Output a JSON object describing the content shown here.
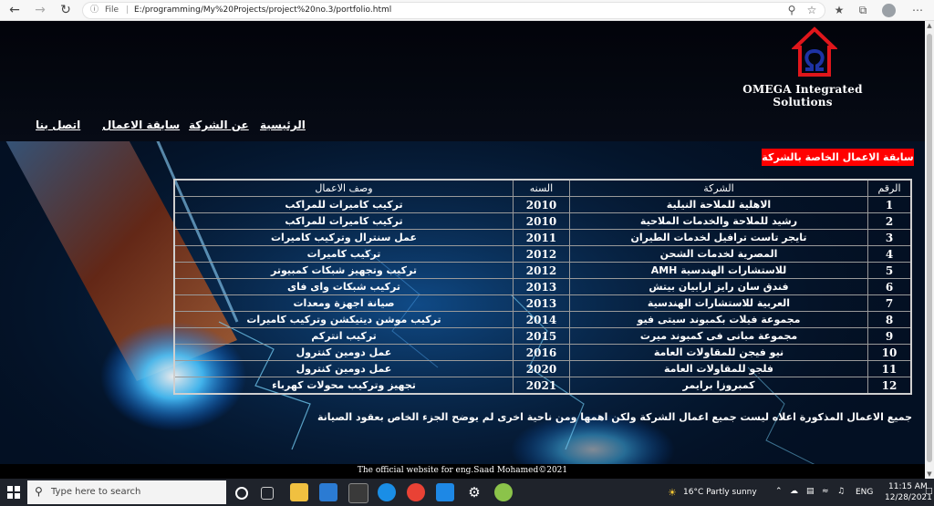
{
  "browser": {
    "address_info": "ⓘ",
    "address_scheme": "File",
    "address_url": "E:/programming/My%20Projects/project%20no.3/portfolio.html"
  },
  "site": {
    "company_name": "OMEGA Integrated Solutions",
    "menu": [
      {
        "label": "الرئيسية"
      },
      {
        "label": "عن الشركة"
      },
      {
        "label": "سابقة الاعمال"
      },
      {
        "label": "اتصل بنا"
      }
    ],
    "section_title": "سابقة الاعمال الخاصة بالشركة",
    "table": {
      "headers": {
        "num": "الرقم",
        "company": "الشركة",
        "year": "السنه",
        "desc": "وصف الاعمال"
      },
      "rows": [
        {
          "num": "1",
          "company": "الاهلية للملاحة النيلية",
          "year": "2010",
          "desc": "تركيب كاميرات للمراكب"
        },
        {
          "num": "2",
          "company": "رشيد للملاحة والخدمات الملاحية",
          "year": "2010",
          "desc": "تركيب كاميرات للمراكب"
        },
        {
          "num": "3",
          "company": "تايجر تاست ترافيل لخدمات الطيران",
          "year": "2011",
          "desc": "عمل سنترال وتركيب كاميرات"
        },
        {
          "num": "4",
          "company": "المصرية لخدمات الشحن",
          "year": "2012",
          "desc": "تركيب كاميرات"
        },
        {
          "num": "5",
          "company": "للاستشارات الهندسية AMH",
          "year": "2012",
          "desc": "تركيب وتجهيز شبكات كمبيوتر"
        },
        {
          "num": "6",
          "company": "فندق سان رايز ارابيان بيتش",
          "year": "2013",
          "desc": "تركيب شبكات واى فاى"
        },
        {
          "num": "7",
          "company": "العربية للاستشارات الهندسية",
          "year": "2013",
          "desc": "صيانة اجهزة ومعدات"
        },
        {
          "num": "8",
          "company": "مجموعة فيلات بكمبوند سيتى فيو",
          "year": "2014",
          "desc": "تركيب موشن ديتيكشن وتركيب كاميرات"
        },
        {
          "num": "9",
          "company": "مجموعة مبانى فى كمبوند ميرت",
          "year": "2015",
          "desc": "تركيب انتركم"
        },
        {
          "num": "10",
          "company": "نيو فيجن للمقاولات العامة",
          "year": "2016",
          "desc": "عمل دومين كنترول"
        },
        {
          "num": "11",
          "company": "فلجو للمقاولات العامة",
          "year": "2020",
          "desc": "عمل دومين كنترول"
        },
        {
          "num": "12",
          "company": "كمبروزا برايمر",
          "year": "2021",
          "desc": "تجهيز وتركيب محولات كهرباء"
        }
      ]
    },
    "note": "جميع الاعمال المذكورة اعلاه ليست جميع اعمال الشركة ولكن اهمها ومن ناحية اخرى لم يوضح الجزء الخاص بعقود الصيانة",
    "footer": "The official website for eng.Saad Mohamed©2021"
  },
  "taskbar": {
    "search_placeholder": "Type here to search",
    "weather": "16°C  Partly sunny",
    "lang": "ENG",
    "time": "11:15 AM",
    "date": "12/28/2021"
  },
  "colors": {
    "accent_red": "#ff0000",
    "page_bg": "#020611"
  }
}
